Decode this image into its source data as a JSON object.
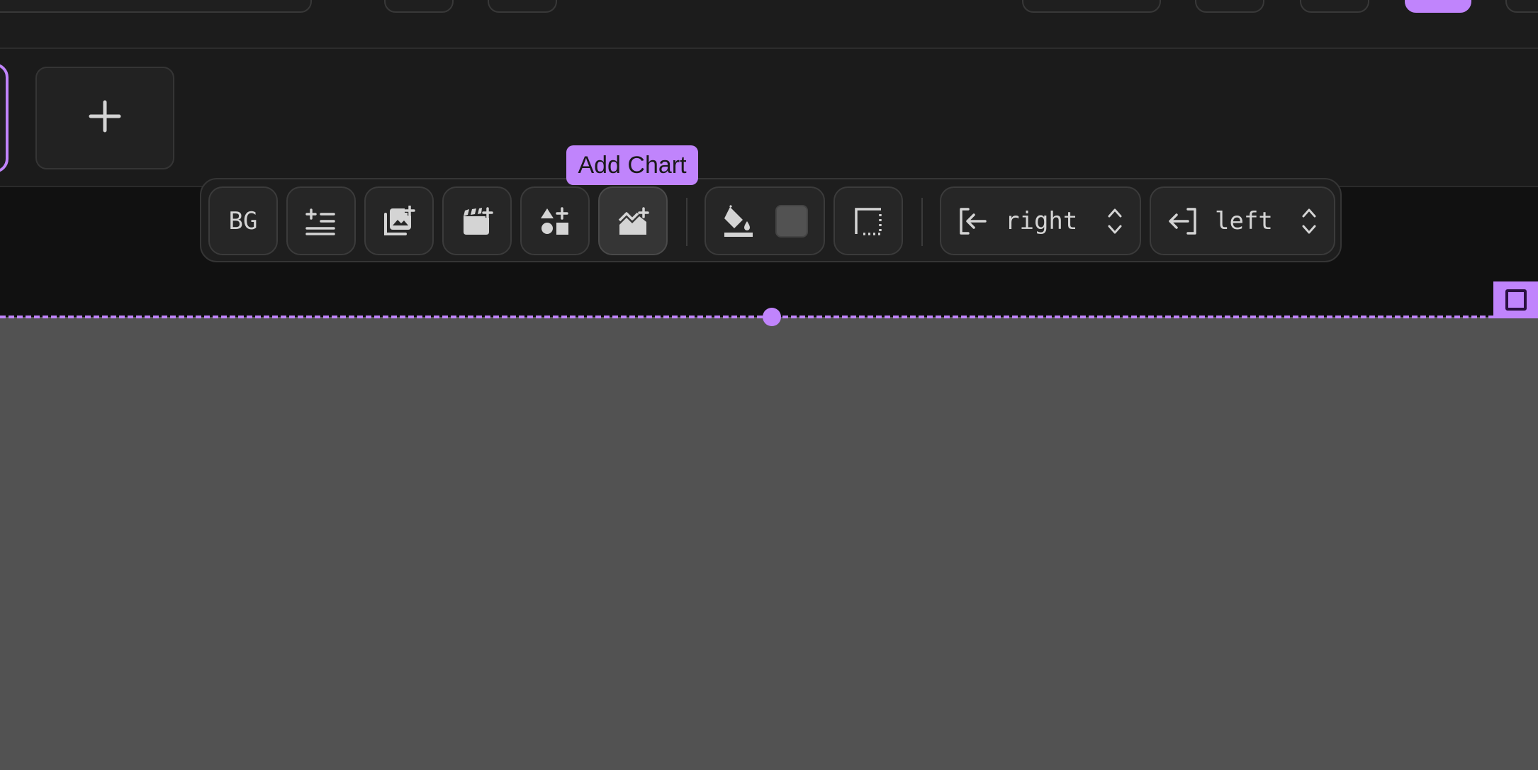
{
  "toolbar": {
    "bg_label": "BG",
    "add_chart_tooltip": "Add Chart",
    "fill_color": "#525252",
    "enter_transition": "right",
    "exit_transition": "left"
  },
  "colors": {
    "accent": "#c084fc",
    "canvas": "#525252",
    "toolbar_bg": "#1e1e1e"
  },
  "icons": [
    "plus-icon",
    "text-align-icon",
    "add-image-icon",
    "add-video-icon",
    "add-shape-icon",
    "add-chart-icon",
    "paint-bucket-icon",
    "border-style-icon",
    "enter-arrow-icon",
    "exit-arrow-icon",
    "up-down-chevron-icon"
  ]
}
